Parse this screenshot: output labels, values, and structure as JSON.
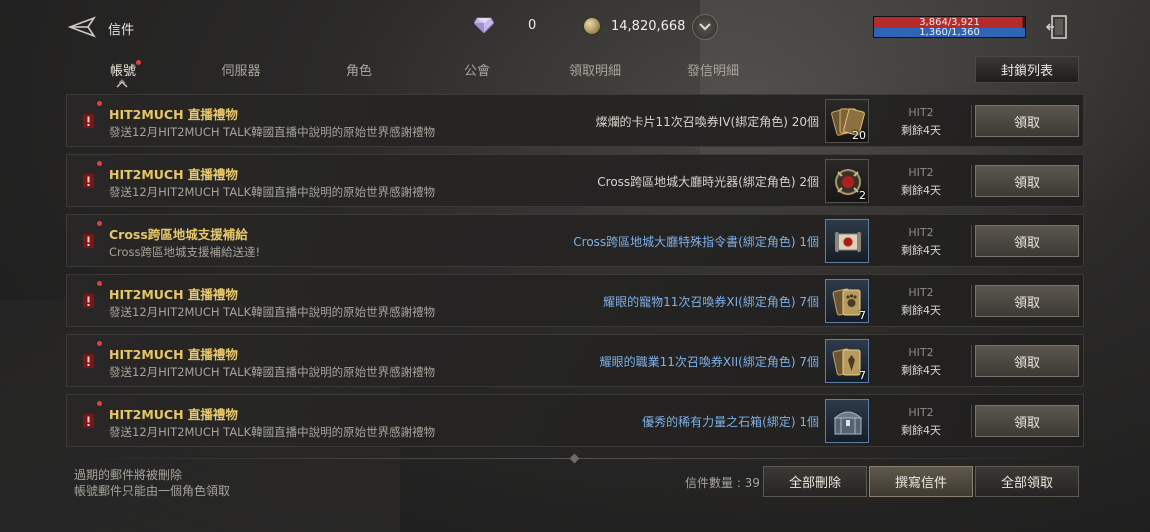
{
  "header": {
    "title": "信件",
    "diamonds": "0",
    "gold": "14,820,668",
    "hp": "3,864/3,921",
    "mp": "1,360/1,360",
    "hp_fraction": 0.985,
    "mp_fraction": 1.0
  },
  "tabs": [
    {
      "label": "帳號",
      "active": true,
      "has_dot": true
    },
    {
      "label": "伺服器",
      "active": false
    },
    {
      "label": "角色",
      "active": false
    },
    {
      "label": "公會",
      "active": false
    },
    {
      "label": "領取明細",
      "active": false
    },
    {
      "label": "發信明細",
      "active": false
    }
  ],
  "lock_list_label": "封鎖列表",
  "mails": [
    {
      "subject": "HIT2MUCH 直播禮物",
      "desc": "發送12月HIT2MUCH TALK韓國直播中說明的原始世界感謝禮物",
      "item": "燦爛的卡片11次召喚券IV(綁定角色) 20個",
      "item_color": "white",
      "item_icon": "cards-icon",
      "qty": "20",
      "sender": "HIT2",
      "expire": "剩餘4天",
      "claim": "領取"
    },
    {
      "subject": "HIT2MUCH 直播禮物",
      "desc": "發送12月HIT2MUCH TALK韓國直播中說明的原始世界感謝禮物",
      "item": "Cross跨區地城大廳時光器(綁定角色) 2個",
      "item_color": "white",
      "item_icon": "time-device-icon",
      "qty": "2",
      "sender": "HIT2",
      "expire": "剩餘4天",
      "claim": "領取"
    },
    {
      "subject": "Cross跨區地城支援補給",
      "desc": "Cross跨區地城支援補給送達!",
      "item": "Cross跨區地城大廳特殊指令書(綁定角色) 1個",
      "item_color": "blue",
      "item_icon": "scroll-icon",
      "qty": "",
      "sender": "HIT2",
      "expire": "剩餘4天",
      "claim": "領取"
    },
    {
      "subject": "HIT2MUCH 直播禮物",
      "desc": "發送12月HIT2MUCH TALK韓國直播中說明的原始世界感謝禮物",
      "item": "耀眼的寵物11次召喚券XI(綁定角色) 7個",
      "item_color": "blue",
      "item_icon": "pet-cards-icon",
      "qty": "7",
      "sender": "HIT2",
      "expire": "剩餘4天",
      "claim": "領取"
    },
    {
      "subject": "HIT2MUCH 直播禮物",
      "desc": "發送12月HIT2MUCH TALK韓國直播中說明的原始世界感謝禮物",
      "item": "耀眼的職業11次召喚券XII(綁定角色) 7個",
      "item_color": "blue",
      "item_icon": "class-cards-icon",
      "qty": "7",
      "sender": "HIT2",
      "expire": "剩餘4天",
      "claim": "領取"
    },
    {
      "subject": "HIT2MUCH 直播禮物",
      "desc": "發送12月HIT2MUCH TALK韓國直播中說明的原始世界感謝禮物",
      "item": "優秀的稀有力量之石箱(綁定) 1個",
      "item_color": "blue",
      "item_icon": "chest-icon",
      "qty": "",
      "sender": "HIT2",
      "expire": "剩餘4天",
      "claim": "領取"
    }
  ],
  "footer": {
    "note1": "過期的郵件將被刪除",
    "note2": "帳號郵件只能由一個角色領取",
    "count": "信件數量 : 39",
    "delete_all": "全部刪除",
    "compose": "撰寫信件",
    "claim_all": "全部領取"
  }
}
